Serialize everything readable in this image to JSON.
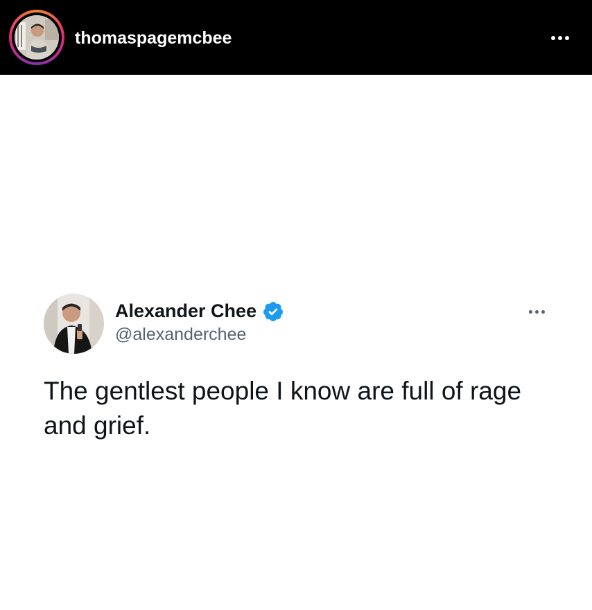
{
  "instagram": {
    "username": "thomaspagemcbee",
    "avatar_icon": "profile-photo",
    "more_icon": "more-horizontal-icon",
    "story_ring_colors": [
      "#f58529",
      "#dd2a7b",
      "#8134af"
    ]
  },
  "tweet": {
    "display_name": "Alexander Chee",
    "handle": "@alexanderchee",
    "verified": true,
    "verified_color": "#1d9bf0",
    "text": "The gentlest people I know are full of rage and grief.",
    "more_icon": "more-horizontal-icon"
  }
}
